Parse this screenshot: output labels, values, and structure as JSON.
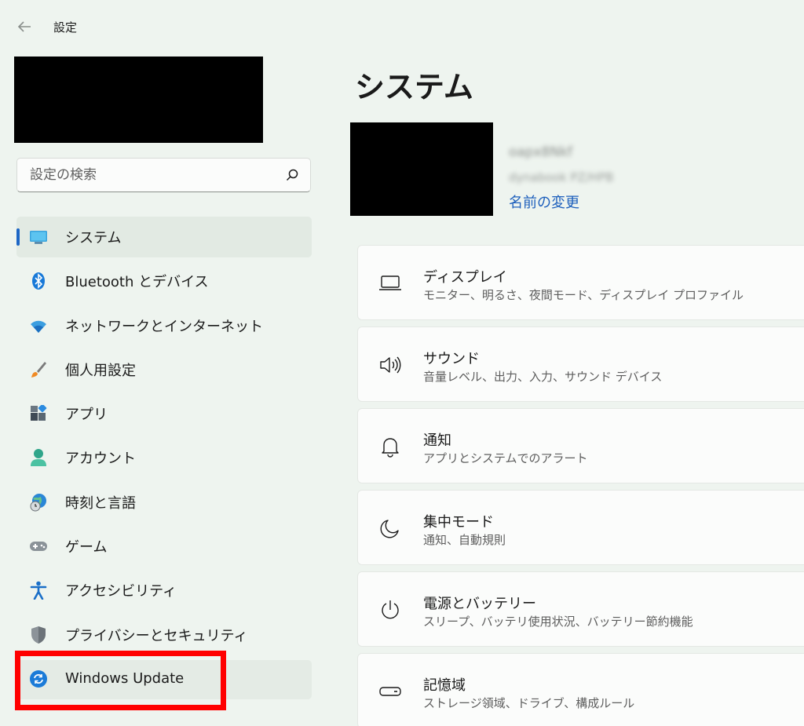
{
  "app": {
    "title": "設定"
  },
  "search": {
    "placeholder": "設定の検索"
  },
  "sidebar": {
    "items": [
      {
        "label": "システム",
        "icon": "monitor-icon",
        "selected": true
      },
      {
        "label": "Bluetooth とデバイス",
        "icon": "bluetooth-icon"
      },
      {
        "label": "ネットワークとインターネット",
        "icon": "wifi-icon"
      },
      {
        "label": "個人用設定",
        "icon": "brush-icon"
      },
      {
        "label": "アプリ",
        "icon": "apps-icon"
      },
      {
        "label": "アカウント",
        "icon": "person-icon"
      },
      {
        "label": "時刻と言語",
        "icon": "globe-clock-icon"
      },
      {
        "label": "ゲーム",
        "icon": "gamepad-icon"
      },
      {
        "label": "アクセシビリティ",
        "icon": "accessibility-icon"
      },
      {
        "label": "プライバシーとセキュリティ",
        "icon": "shield-icon"
      },
      {
        "label": "Windows Update",
        "icon": "sync-icon"
      }
    ]
  },
  "main": {
    "title": "システム",
    "device": {
      "name": "oapx8Nkf",
      "model": "dynabook PZ/HPB",
      "rename_link": "名前の変更"
    },
    "cards": [
      {
        "title": "ディスプレイ",
        "desc": "モニター、明るさ、夜間モード、ディスプレイ プロファイル",
        "icon": "laptop-icon"
      },
      {
        "title": "サウンド",
        "desc": "音量レベル、出力、入力、サウンド デバイス",
        "icon": "speaker-icon"
      },
      {
        "title": "通知",
        "desc": "アプリとシステムでのアラート",
        "icon": "bell-icon"
      },
      {
        "title": "集中モード",
        "desc": "通知、自動規則",
        "icon": "moon-icon"
      },
      {
        "title": "電源とバッテリー",
        "desc": "スリープ、バッテリ使用状況、バッテリー節約機能",
        "icon": "power-icon"
      },
      {
        "title": "記憶域",
        "desc": "ストレージ領域、ドライブ、構成ルール",
        "icon": "storage-icon"
      }
    ]
  },
  "colors": {
    "accent": "#1d66c5",
    "highlight": "#ff0000",
    "background": "#eef4ef"
  }
}
